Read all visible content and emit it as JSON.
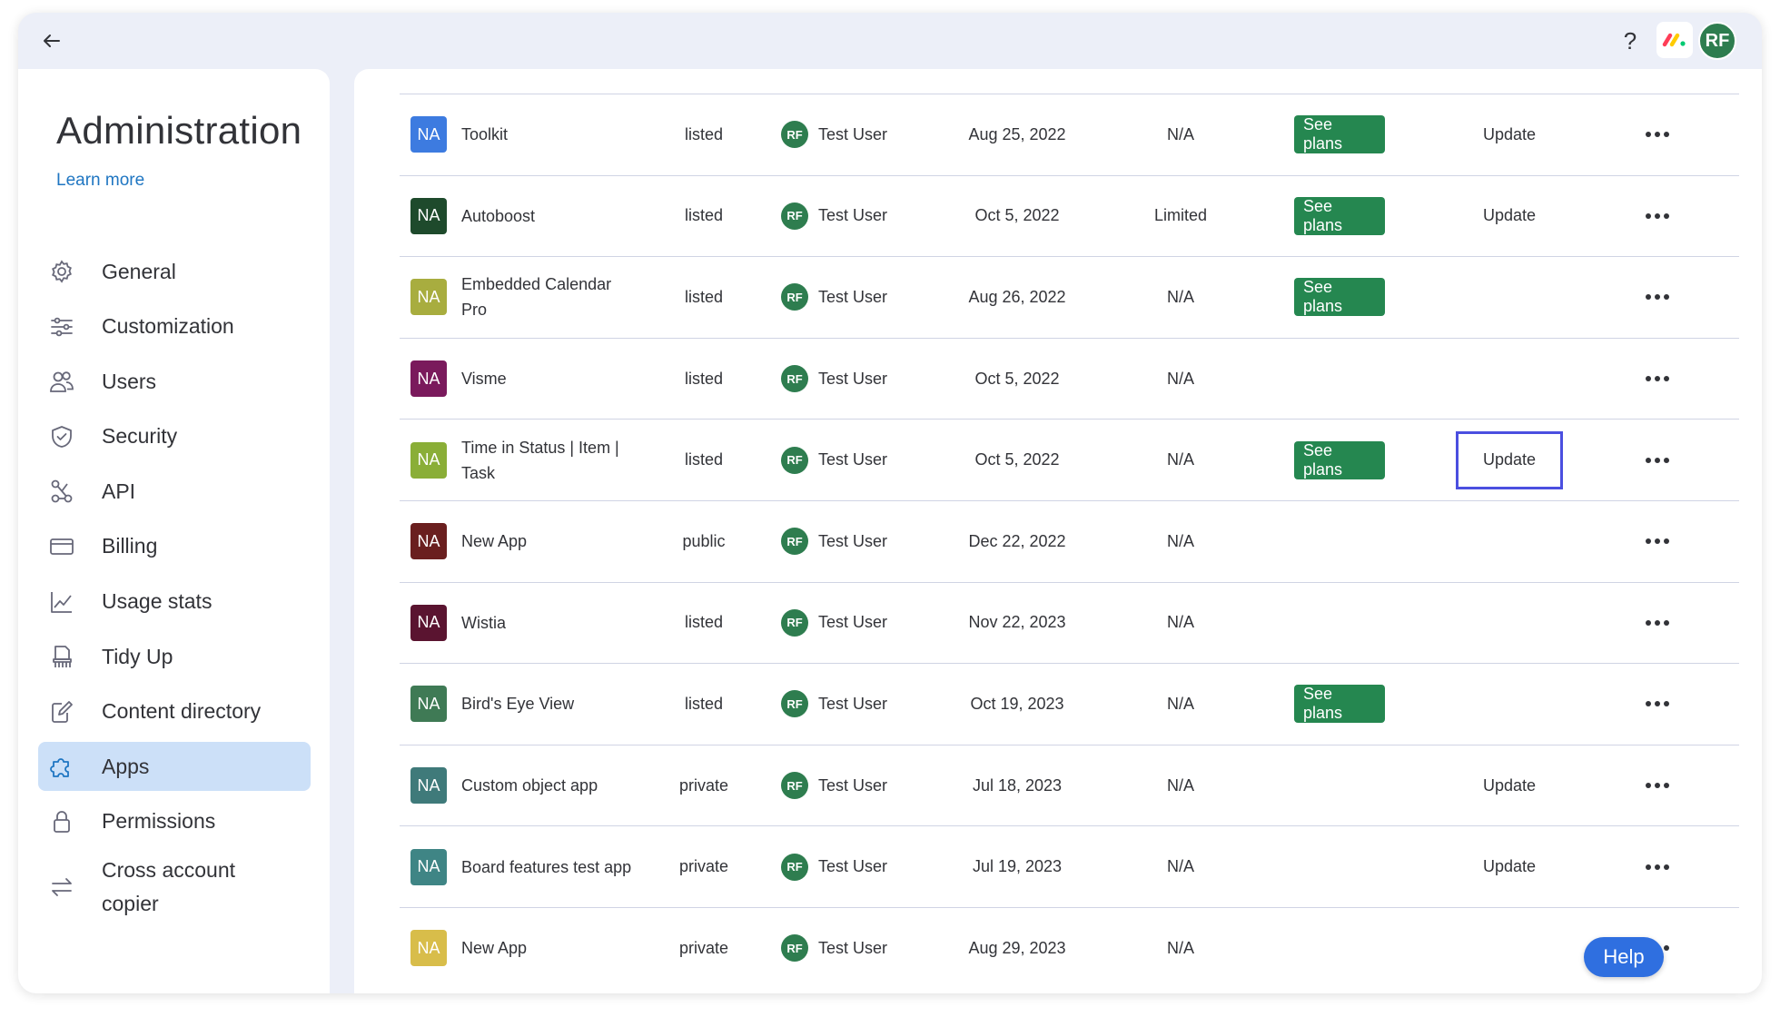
{
  "topbar": {
    "help_symbol": "?",
    "avatar_initials": "RF"
  },
  "sidebar": {
    "title": "Administration",
    "learn_more": "Learn more",
    "items": [
      {
        "label": "General",
        "icon": "gear-icon"
      },
      {
        "label": "Customization",
        "icon": "sliders-icon"
      },
      {
        "label": "Users",
        "icon": "users-icon"
      },
      {
        "label": "Security",
        "icon": "shield-icon"
      },
      {
        "label": "API",
        "icon": "api-icon"
      },
      {
        "label": "Billing",
        "icon": "card-icon"
      },
      {
        "label": "Usage stats",
        "icon": "chart-icon"
      },
      {
        "label": "Tidy Up",
        "icon": "broom-icon"
      },
      {
        "label": "Content directory",
        "icon": "edit-doc-icon"
      },
      {
        "label": "Apps",
        "icon": "puzzle-icon",
        "active": true
      },
      {
        "label": "Permissions",
        "icon": "lock-icon"
      },
      {
        "label": "Cross account copier",
        "icon": "swap-icon"
      }
    ]
  },
  "table": {
    "rows": [
      {
        "badge": "NA",
        "badge_color": "#3d7be0",
        "name": "Toolkit",
        "status": "listed",
        "user_initials": "RF",
        "user": "Test User",
        "date": "Aug 25, 2022",
        "limit": "N/A",
        "plans": "See plans",
        "update": "Update"
      },
      {
        "badge": "NA",
        "badge_color": "#1e4a2c",
        "name": "Autoboost",
        "status": "listed",
        "user_initials": "RF",
        "user": "Test User",
        "date": "Oct 5, 2022",
        "limit": "Limited",
        "plans": "See plans",
        "update": "Update"
      },
      {
        "badge": "NA",
        "badge_color": "#a8ad3f",
        "name": "Embedded Calendar Pro",
        "status": "listed",
        "user_initials": "RF",
        "user": "Test User",
        "date": "Aug 26, 2022",
        "limit": "N/A",
        "plans": "See plans",
        "update": ""
      },
      {
        "badge": "NA",
        "badge_color": "#7a1a5c",
        "name": "Visme",
        "status": "listed",
        "user_initials": "RF",
        "user": "Test User",
        "date": "Oct 5, 2022",
        "limit": "N/A",
        "plans": "",
        "update": ""
      },
      {
        "badge": "NA",
        "badge_color": "#8aae37",
        "name": "Time in Status | Item | Task",
        "status": "listed",
        "user_initials": "RF",
        "user": "Test User",
        "date": "Oct 5, 2022",
        "limit": "N/A",
        "plans": "See plans",
        "update": "Update",
        "focused": true
      },
      {
        "badge": "NA",
        "badge_color": "#6a1f1f",
        "name": "New App",
        "status": "public",
        "user_initials": "RF",
        "user": "Test User",
        "date": "Dec 22, 2022",
        "limit": "N/A",
        "plans": "",
        "update": ""
      },
      {
        "badge": "NA",
        "badge_color": "#5a1430",
        "name": "Wistia",
        "status": "listed",
        "user_initials": "RF",
        "user": "Test User",
        "date": "Nov 22, 2023",
        "limit": "N/A",
        "plans": "",
        "update": ""
      },
      {
        "badge": "NA",
        "badge_color": "#3f7a55",
        "name": "Bird's Eye View",
        "status": "listed",
        "user_initials": "RF",
        "user": "Test User",
        "date": "Oct 19, 2023",
        "limit": "N/A",
        "plans": "See plans",
        "update": ""
      },
      {
        "badge": "NA",
        "badge_color": "#3f7a7a",
        "name": "Custom object app",
        "status": "private",
        "user_initials": "RF",
        "user": "Test User",
        "date": "Jul 18, 2023",
        "limit": "N/A",
        "plans": "",
        "update": "Update"
      },
      {
        "badge": "NA",
        "badge_color": "#3f8585",
        "name": "Board features test app",
        "status": "private",
        "user_initials": "RF",
        "user": "Test User",
        "date": "Jul 19, 2023",
        "limit": "N/A",
        "plans": "",
        "update": "Update"
      },
      {
        "badge": "NA",
        "badge_color": "#d8bd4a",
        "name": "New App",
        "status": "private",
        "user_initials": "RF",
        "user": "Test User",
        "date": "Aug 29, 2023",
        "limit": "N/A",
        "plans": "",
        "update": ""
      }
    ]
  },
  "help_button": "Help"
}
